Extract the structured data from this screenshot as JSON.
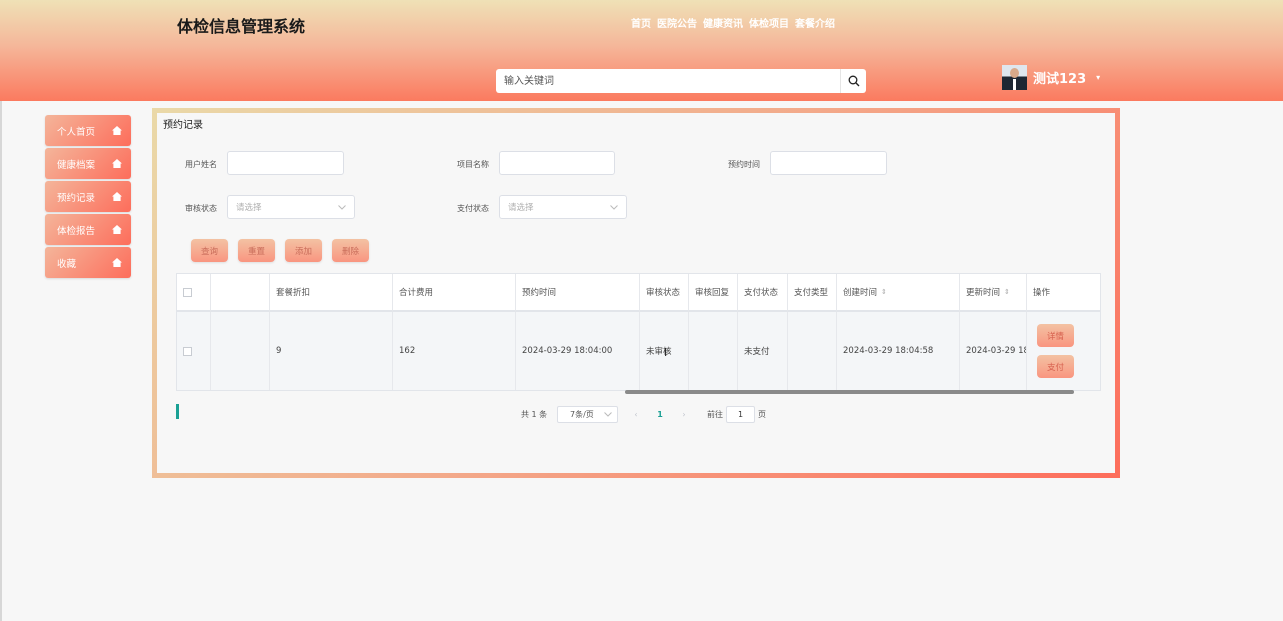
{
  "header": {
    "logo": "体检信息管理系统",
    "nav": [
      "首页",
      "医院公告",
      "健康资讯",
      "体检项目",
      "套餐介绍"
    ],
    "search_placeholder": "输入关键词",
    "user_name": "测试123"
  },
  "sidebar": {
    "items": [
      {
        "label": "个人首页"
      },
      {
        "label": "健康档案"
      },
      {
        "label": "预约记录"
      },
      {
        "label": "体检报告"
      },
      {
        "label": "收藏"
      }
    ]
  },
  "main": {
    "title": "预约记录",
    "filters": {
      "username_label": "用户姓名",
      "project_label": "项目名称",
      "time_label": "预约时间",
      "audit_label": "审核状态",
      "audit_placeholder": "请选择",
      "pay_label": "支付状态",
      "pay_placeholder": "请选择"
    },
    "buttons": {
      "query": "查询",
      "reset": "重置",
      "add": "添加",
      "delete": "删除"
    },
    "table": {
      "headers": [
        "套餐折扣",
        "合计费用",
        "预约时间",
        "审核状态",
        "审核回复",
        "支付状态",
        "支付类型",
        "创建时间",
        "更新时间",
        "操作"
      ],
      "row": {
        "discount": "9",
        "total": "162",
        "booking_time": "2024-03-29 18:04:00",
        "audit_status": "未审核",
        "audit_reply": "",
        "pay_status": "未支付",
        "pay_type": "",
        "created": "2024-03-29 18:04:58",
        "updated": "2024-03-29 18",
        "detail_btn": "详情",
        "pay_btn": "支付"
      }
    },
    "pagination": {
      "total": "共 1 条",
      "page_size": "7条/页",
      "current_page": "1",
      "goto_prefix": "前往",
      "goto_value": "1",
      "goto_suffix": "页"
    }
  }
}
